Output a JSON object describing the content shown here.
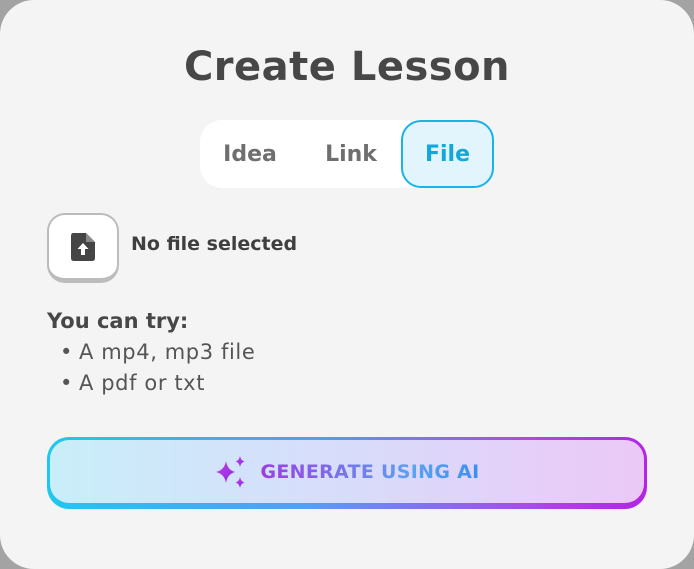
{
  "dialog": {
    "title": "Create Lesson"
  },
  "tabs": [
    {
      "label": "Idea",
      "selected": false
    },
    {
      "label": "Link",
      "selected": false
    },
    {
      "label": "File",
      "selected": true
    }
  ],
  "upload": {
    "icon": "file-upload-icon",
    "status": "No file selected"
  },
  "suggestions": {
    "heading": "You can try:",
    "items": [
      "A mp4, mp3 file",
      "A pdf or txt"
    ]
  },
  "generate": {
    "label": "GENERATE USING AI",
    "icon": "sparkles-icon"
  },
  "colors": {
    "accent": "#1bb3e6",
    "gradient_start": "#1ec8ec",
    "gradient_end": "#b424e6"
  }
}
